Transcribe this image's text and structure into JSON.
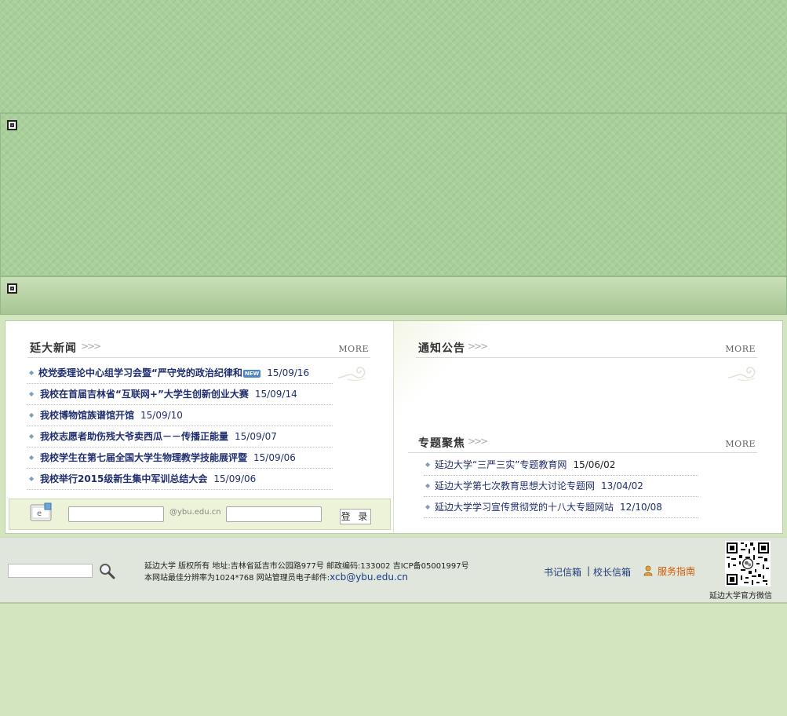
{
  "news": {
    "title": "延大新闻",
    "more": "MORE",
    "new_badge": "NEW",
    "items": [
      {
        "title": "校党委理论中心组学习会暨“严守党的政治纪律和",
        "date": "15/09/16"
      },
      {
        "title": "我校在首届吉林省“互联网+”大学生创新创业大赛",
        "date": "15/09/14"
      },
      {
        "title": "我校博物馆族谱馆开馆",
        "date": "15/09/10"
      },
      {
        "title": "我校志愿者助伤残大爷卖西瓜－－传播正能量",
        "date": "15/09/07"
      },
      {
        "title": "我校学生在第七届全国大学生物理教学技能展评暨",
        "date": "15/09/06"
      },
      {
        "title": "我校举行2015级新生集中军训总结大会",
        "date": "15/09/06"
      }
    ]
  },
  "notice": {
    "title": "通知公告",
    "more": "MORE"
  },
  "topics": {
    "title": "专题聚焦",
    "more": "MORE",
    "items": [
      {
        "title": "延边大学“三严三实”专题教育网",
        "date": "15/06/02"
      },
      {
        "title": "延边大学第七次教育思想大讨论专题网",
        "date": "13/04/02"
      },
      {
        "title": "延边大学学习宣传贯彻党的十八大专题网站",
        "date": "12/10/08"
      }
    ]
  },
  "login": {
    "domain": "@ybu.edu.cn",
    "button": "登 录"
  },
  "footer": {
    "line1": "延边大学  版权所有  地址:吉林省延吉市公园路977号  邮政编码:133002 吉ICP备05001997号",
    "line2_prefix": "本网站最佳分辨率为1024*768 网站管理员电子邮件:",
    "email": "xcb@ybu.edu.cn",
    "secretary_mailbox": "书记信箱",
    "separator": "|",
    "president_mailbox": "校长信箱",
    "service_guide": "服务指南",
    "qr_caption": "延边大学官方微信"
  },
  "icons": {
    "search": "search-icon",
    "mail": "mail-icon",
    "user": "user-icon",
    "plugin": "plugin-placeholder-icon"
  },
  "colors": {
    "banner_green": "#a9cf9a",
    "page_bg": "#d3e5be",
    "link_blue": "#1f2e6e",
    "service_orange": "#d05a00"
  }
}
